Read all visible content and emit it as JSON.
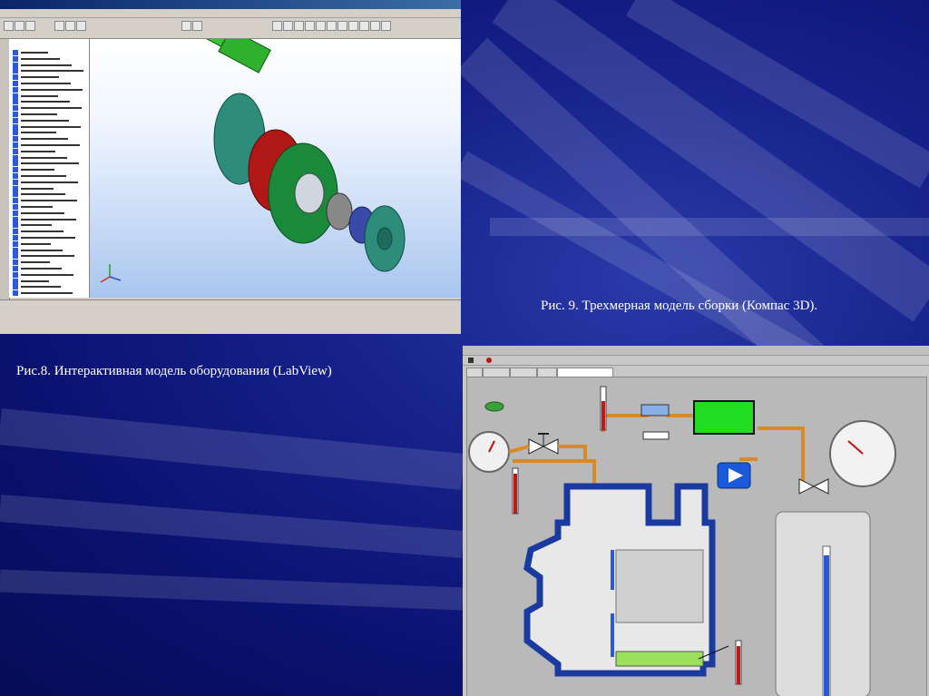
{
  "slide": {
    "caption_top_right": "Рис. 9. Трехмерная модель сборки (Компас 3D).",
    "caption_left": "Рис.8. Интерактивная модель оборудования (LabView)"
  },
  "colors": {
    "background": "#0a1466",
    "labview_green": "#22dd22",
    "pump_blue": "#1a5ad8",
    "thermo_red": "#cc2020"
  }
}
